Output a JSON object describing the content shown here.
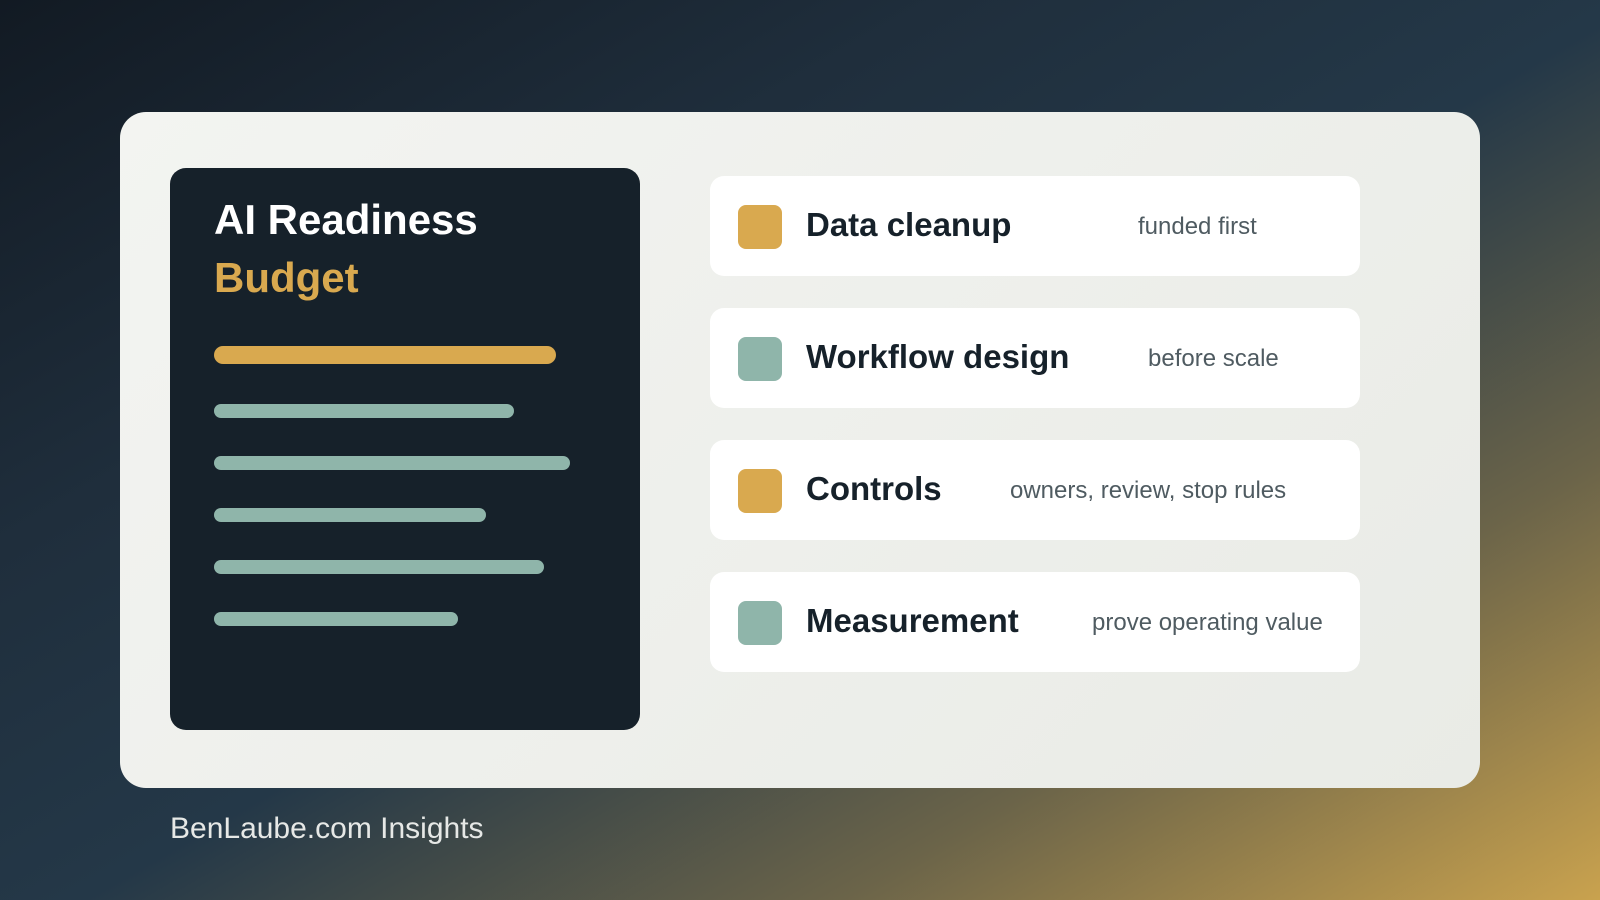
{
  "panel": {
    "title_line1": "AI Readiness",
    "title_line2": "Budget",
    "doc_line_count": 6
  },
  "items": [
    {
      "label": "Data cleanup",
      "note": "funded first",
      "swatch_color": "#d9a94f"
    },
    {
      "label": "Workflow design",
      "note": "before scale",
      "swatch_color": "#8fb5aa"
    },
    {
      "label": "Controls",
      "note": "owners, review, stop rules",
      "swatch_color": "#d9a94f"
    },
    {
      "label": "Measurement",
      "note": "prove operating value",
      "swatch_color": "#8fb5aa"
    }
  ],
  "footer": {
    "brand": "BenLaube.com Insights"
  },
  "colors": {
    "gold": "#d9a94f",
    "sage": "#8fb5aa",
    "navy": "#16212a"
  }
}
